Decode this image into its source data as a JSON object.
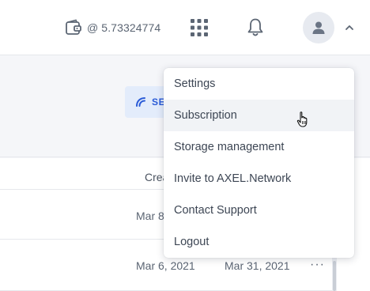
{
  "header": {
    "wallet_balance": "@ 5.73324774",
    "icons": {
      "wallet": "wallet-icon",
      "apps": "apps-grid-icon",
      "notifications": "bell-icon",
      "avatar": "user-icon",
      "chevron": "chevron-up-icon"
    }
  },
  "toolbar": {
    "secure_button_label": "SEC"
  },
  "table": {
    "column_header_partial": "Crea",
    "rows": [
      {
        "created": "Mar 8",
        "modified": ""
      },
      {
        "created": "Mar 6, 2021",
        "modified": "Mar 31, 2021",
        "more": "···"
      }
    ]
  },
  "menu": {
    "hovered_index": 1,
    "items": [
      {
        "label": "Settings"
      },
      {
        "label": "Subscription"
      },
      {
        "label": "Storage management"
      },
      {
        "label": "Invite to AXEL.Network"
      },
      {
        "label": "Contact Support"
      },
      {
        "label": "Logout"
      }
    ]
  },
  "colors": {
    "accent": "#2a5bd7",
    "header_bg": "#ffffff",
    "page_bg": "#f5f6f9",
    "menu_hover": "#f1f3f6"
  }
}
